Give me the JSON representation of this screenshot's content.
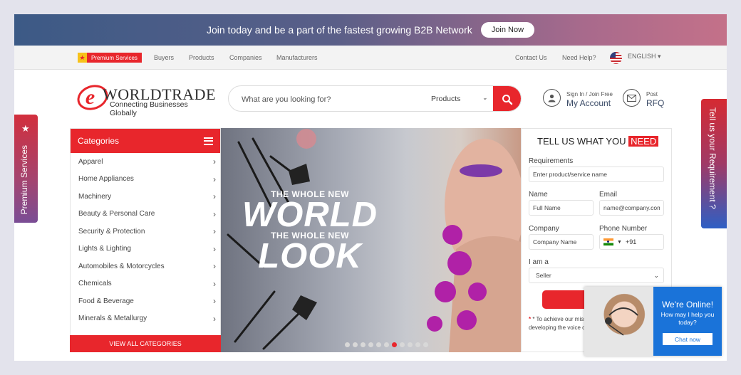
{
  "banner": {
    "text": "Join today and be a part of the fastest growing B2B Network",
    "join_label": "Join Now"
  },
  "topnav": {
    "premium_label": "Premium Services",
    "links": [
      "Buyers",
      "Products",
      "Companies",
      "Manufacturers"
    ],
    "contact": "Contact Us",
    "help": "Need Help?",
    "language": "ENGLISH"
  },
  "logo": {
    "mark": "e",
    "name": "WORLDTRADE",
    "tagline": "Connecting Businesses Globally"
  },
  "search": {
    "placeholder": "What are you looking for?",
    "category": "Products"
  },
  "account": {
    "small": "Sign In / Join Free",
    "big": "My Account"
  },
  "rfq": {
    "small": "Post",
    "big": "RFQ"
  },
  "categories": {
    "title": "Categories",
    "items": [
      "Apparel",
      "Home Appliances",
      "Machinery",
      "Beauty & Personal Care",
      "Security & Protection",
      "Lights & Lighting",
      "Automobiles  & Motorcycles",
      "Chemicals",
      "Food & Beverage",
      "Minerals & Metallurgy"
    ],
    "view_all": "VIEW ALL CATEGORIES"
  },
  "hero": {
    "line1": "THE WHOLE NEW",
    "word1": "WORLD",
    "line2": "THE WHOLE NEW",
    "word2": "LOOK",
    "slide_count": 11,
    "active_slide": 7
  },
  "req_form": {
    "title_main": "TELL US WHAT YOU ",
    "title_highlight": "NEED",
    "requirements_label": "Requirements",
    "requirements_placeholder": "Enter product/service name",
    "name_label": "Name",
    "name_placeholder": "Full Name",
    "email_label": "Email",
    "email_placeholder": "name@company.com",
    "company_label": "Company",
    "company_placeholder": "Company Name",
    "phone_label": "Phone Number",
    "phone_code": "+91",
    "iam_label": "I am a",
    "iam_value": "Seller",
    "submit_label": "S",
    "note": "* To achieve our missi functionalities to buye developing the voice o"
  },
  "side_left": {
    "label": "Premium Services"
  },
  "side_right": {
    "label": "Tell us your Requirement ?"
  },
  "chat": {
    "title": "We're Online!",
    "subtitle": "How may I help you today?",
    "button": "Chat now"
  },
  "colors": {
    "brand_red": "#e8262c",
    "chat_blue": "#1a73d9"
  }
}
